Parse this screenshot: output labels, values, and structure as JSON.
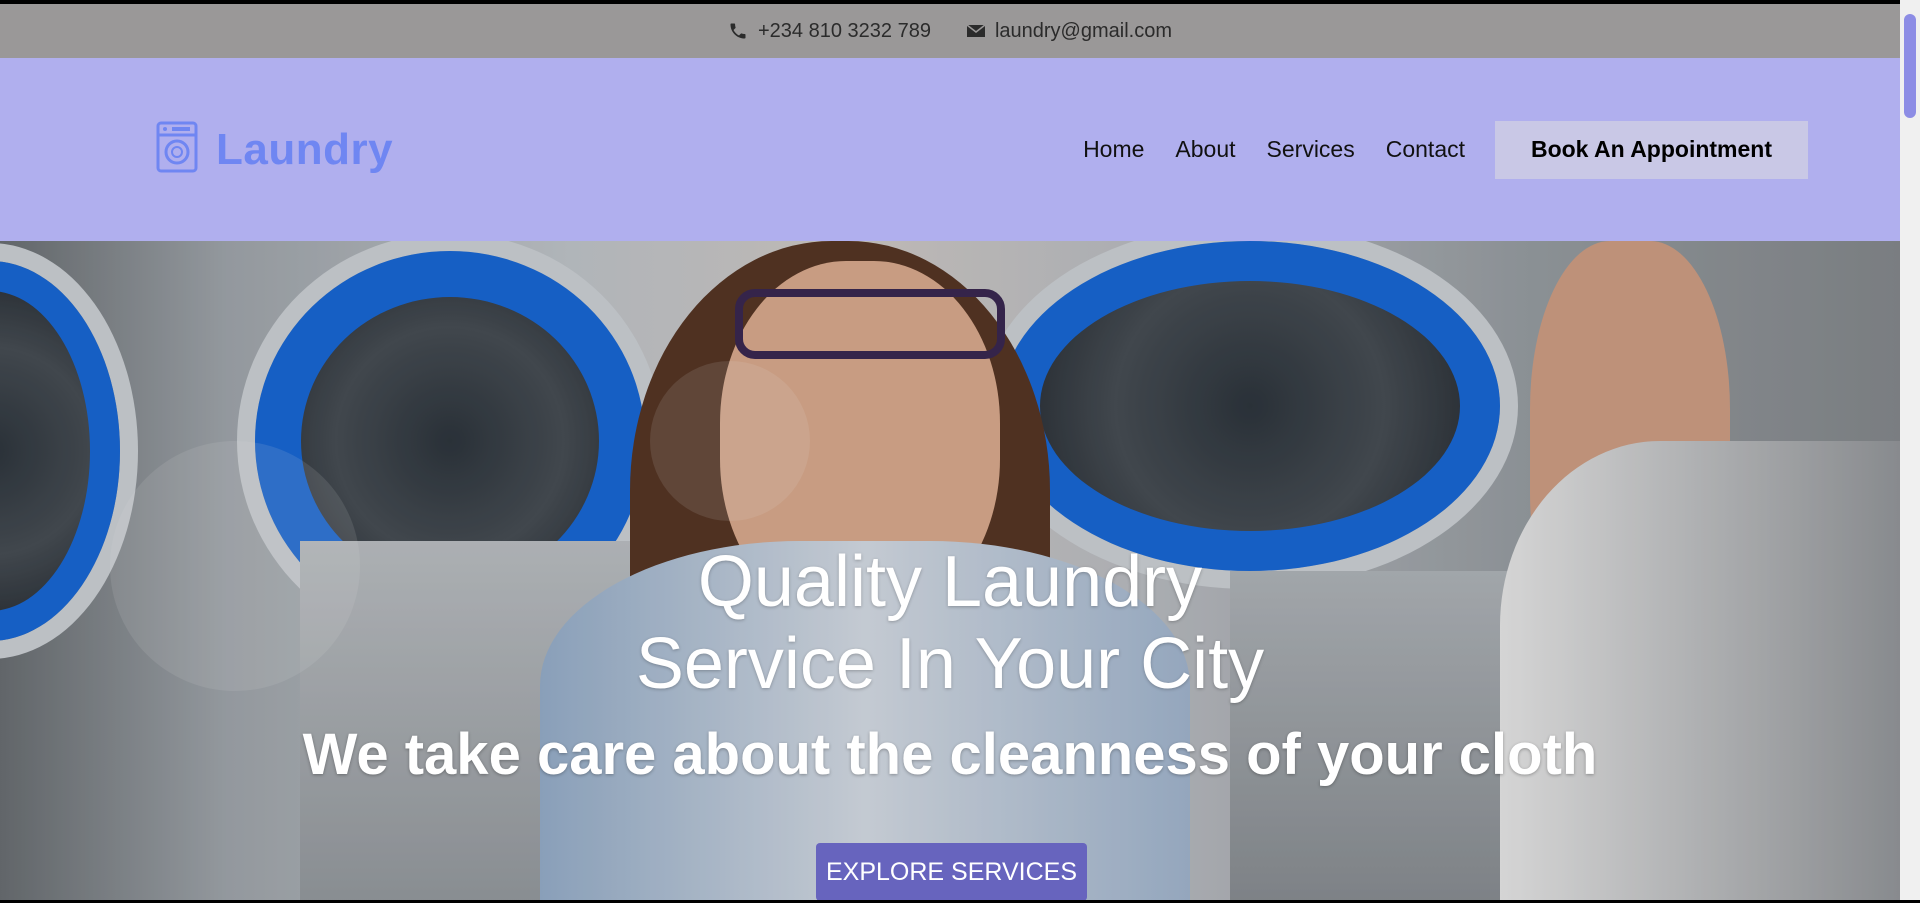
{
  "topbar": {
    "phone": "+234 810 3232 789",
    "email": "laundry@gmail.com",
    "phone_icon": "phone-icon",
    "email_icon": "envelope-icon"
  },
  "header": {
    "logo_text": "Laundry",
    "logo_icon": "washing-machine-icon",
    "nav": [
      "Home",
      "About",
      "Services",
      "Contact"
    ],
    "cta": "Book An Appointment"
  },
  "hero": {
    "title_line1": "Quality Laundry",
    "title_line2": "Service In Your City",
    "subtitle": "We take care about the cleanness of your cloth",
    "button": "EXPLORE SERVICES"
  },
  "colors": {
    "topbar_bg": "#9a9898",
    "header_bg": "#b0afee",
    "logo": "#6f86f2",
    "cta_bg": "#c9c8e6",
    "explore_bg": "#6764be"
  }
}
